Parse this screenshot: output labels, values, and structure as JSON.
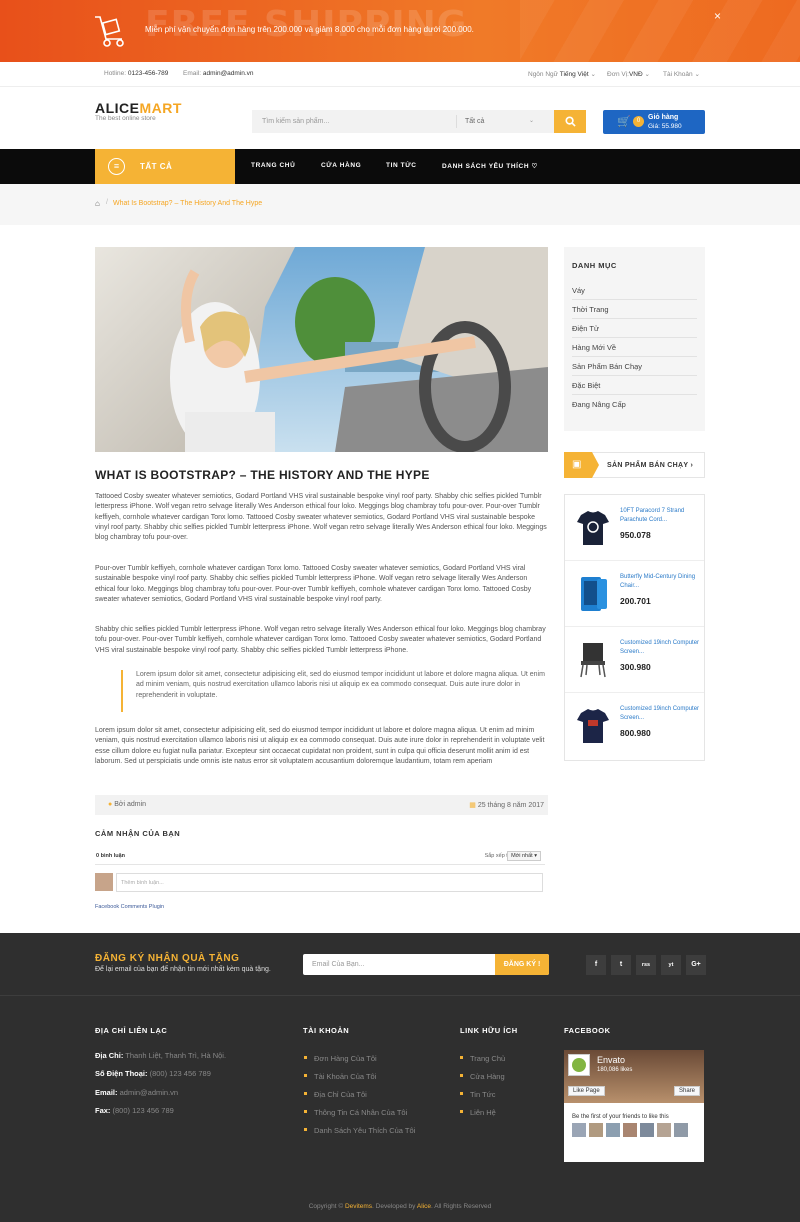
{
  "banner": {
    "bg_text": "FREE SHIPPING",
    "message": "Miễn phí vận chuyển đơn hàng trên 200.000 và giảm 8.000 cho mỗi đơn hàng dưới 200.000.",
    "close": "×"
  },
  "topbar": {
    "hotline_label": "Hotline:",
    "hotline": "0123-456-789",
    "email_label": "Email:",
    "email": "admin@admin.vn",
    "lang_label": "Ngôn Ngữ",
    "lang": "Tiếng Việt",
    "currency_label": "Đơn Vị:",
    "currency": "VNĐ",
    "account": "Tài Khoản"
  },
  "header": {
    "logo_a": "ALICE",
    "logo_b": "MART",
    "tagline": "The best online store",
    "search_placeholder": "Tìm kiếm sản phẩm...",
    "search_category": "Tất cả",
    "cart_count": "0",
    "cart_label": "Giỏ hàng",
    "cart_price": "Giá: 55.980"
  },
  "nav": {
    "all": "TẤT CẢ",
    "items": [
      "TRANG CHỦ",
      "CỬA HÀNG",
      "TIN TỨC",
      "DANH SÁCH YÊU THÍCH ♡"
    ]
  },
  "breadcrumb": {
    "current": "What Is Bootstrap? – The History And The Hype"
  },
  "post": {
    "title": "WHAT IS BOOTSTRAP? – THE HISTORY AND THE HYPE",
    "p1": "Tattooed Cosby sweater whatever semiotics, Godard Portland VHS viral sustainable bespoke vinyl roof party. Shabby chic selfies pickled Tumblr letterpress iPhone. Wolf vegan retro selvage literally Wes Anderson ethical four loko. Meggings blog chambray tofu pour-over. Pour-over Tumblr keffiyeh, cornhole whatever cardigan Tonx lomo. Tattooed Cosby sweater whatever semiotics, Godard Portland VHS viral sustainable bespoke vinyl roof party. Shabby chic selfies pickled Tumblr letterpress iPhone. Wolf vegan retro selvage literally Wes Anderson ethical four loko. Meggings blog chambray tofu pour-over.",
    "p2": "Pour-over Tumblr keffiyeh, cornhole whatever cardigan Tonx lomo. Tattooed Cosby sweater whatever semiotics, Godard Portland VHS viral sustainable bespoke vinyl roof party. Shabby chic selfies pickled Tumblr letterpress iPhone. Wolf vegan retro selvage literally Wes Anderson ethical four loko. Meggings blog chambray tofu pour-over. Pour-over Tumblr keffiyeh, cornhole whatever cardigan Tonx lomo. Tattooed Cosby sweater whatever semiotics, Godard Portland VHS viral sustainable bespoke vinyl roof party.",
    "p3": "Shabby chic selfies pickled Tumblr letterpress iPhone. Wolf vegan retro selvage literally Wes Anderson ethical four loko. Meggings blog chambray tofu pour-over. Pour-over Tumblr keffiyeh, cornhole whatever cardigan Tonx lomo. Tattooed Cosby sweater whatever semiotics, Godard Portland VHS viral sustainable bespoke vinyl roof party. Shabby chic selfies pickled Tumblr letterpress iPhone.",
    "quote": "Lorem ipsum dolor sit amet, consectetur adipisicing elit, sed do eiusmod tempor incididunt ut labore et dolore magna aliqua. Ut enim ad minim veniam, quis nostrud exercitation ullamco laboris nisi ut aliquip ex ea commodo consequat. Duis aute irure dolor in reprehenderit in voluptate.",
    "p4": "Lorem ipsum dolor sit amet, consectetur adipisicing elit, sed do eiusmod tempor incididunt ut labore et dolore magna aliqua. Ut enim ad minim veniam, quis nostrud exercitation ullamco laboris nisi ut aliquip ex ea commodo consequat. Duis aute irure dolor in reprehenderit in voluptate velit esse cillum dolore eu fugiat nulla pariatur. Excepteur sint occaecat cupidatat non proident, sunt in culpa qui officia deserunt mollit anim id est laborum. Sed ut perspiciatis unde omnis iste natus error sit voluptatem accusantium doloremque laudantium, totam rem aperiam",
    "author": "Bởi admin",
    "date": "25 tháng 8 năm 2017"
  },
  "comments": {
    "title": "CẢM NHẬN CỦA BẠN",
    "count": "0 bình luận",
    "sort_label": "Sắp xếp theo",
    "sort_value": "Mới nhất ▾",
    "placeholder": "Thêm bình luận...",
    "plugin": "Facebook Comments Plugin"
  },
  "sidebar": {
    "title": "DANH MỤC",
    "items": [
      "Váy",
      "Thời Trang",
      "Điện Tử",
      "Hàng Mới Về",
      "Sản Phẩm Bán Chạy",
      "Đặc Biệt",
      "Đang Nâng Cấp"
    ]
  },
  "bestsellers": {
    "title": "SẢN PHẨM BÁN CHẠY",
    "arrow": "›",
    "items": [
      {
        "name": "10FT Paracord 7 Strand Parachute Cord...",
        "price": "950.078"
      },
      {
        "name": "Butterfly Mid-Century Dining Chair...",
        "price": "200.701"
      },
      {
        "name": "Customized 19inch Computer Screen...",
        "price": "300.980"
      },
      {
        "name": "Customized 19inch Computer Screen...",
        "price": "800.980"
      }
    ]
  },
  "footer": {
    "nl_title": "ĐĂNG KÝ NHẬN QUÀ TẶNG",
    "nl_sub": "Để lại email của bạn để nhận tin mới nhất kèm quà tặng.",
    "email_placeholder": "Email Của Bạn...",
    "subscribe": "ĐĂNG KÝ !",
    "social": [
      "f",
      "t",
      "rss",
      "yt",
      "G+"
    ],
    "contact_title": "ĐỊA CHỈ LIÊN LẠC",
    "contact": [
      {
        "k": "Địa Chỉ:",
        "v": "Thanh Liệt, Thanh Trì, Hà Nội."
      },
      {
        "k": "Số Điện Thoại:",
        "v": "(800) 123 456 789"
      },
      {
        "k": "Email:",
        "v": "admin@admin.vn"
      },
      {
        "k": "Fax:",
        "v": "(800) 123 456 789"
      }
    ],
    "account_title": "TÀI KHOẢN",
    "account": [
      "Đơn Hàng Của Tôi",
      "Tài Khoản Của Tôi",
      "Địa Chỉ Của Tôi",
      "Thông Tin Cá Nhân Của Tôi",
      "Danh Sách Yêu Thích Của Tôi"
    ],
    "links_title": "LINK HỮU ÍCH",
    "links": [
      "Trang Chủ",
      "Cửa Hàng",
      "Tin Tức",
      "Liên Hệ"
    ],
    "fb_title": "FACEBOOK",
    "fb": {
      "name": "Envato",
      "likes": "180,086 likes",
      "like": "Like Page",
      "share": "Share",
      "friends": "Be the first of your friends to like this"
    },
    "copy_a": "Copyright ©",
    "copy_b": "Devitems",
    "copy_c": ". Developed by",
    "copy_d": "Alice",
    "copy_e": ". All Rights Reserved"
  },
  "colors": {
    "accent": "#f5b335",
    "orange": "#ef6b22",
    "cart": "#1e66c3",
    "footer": "#2f2f2f"
  }
}
